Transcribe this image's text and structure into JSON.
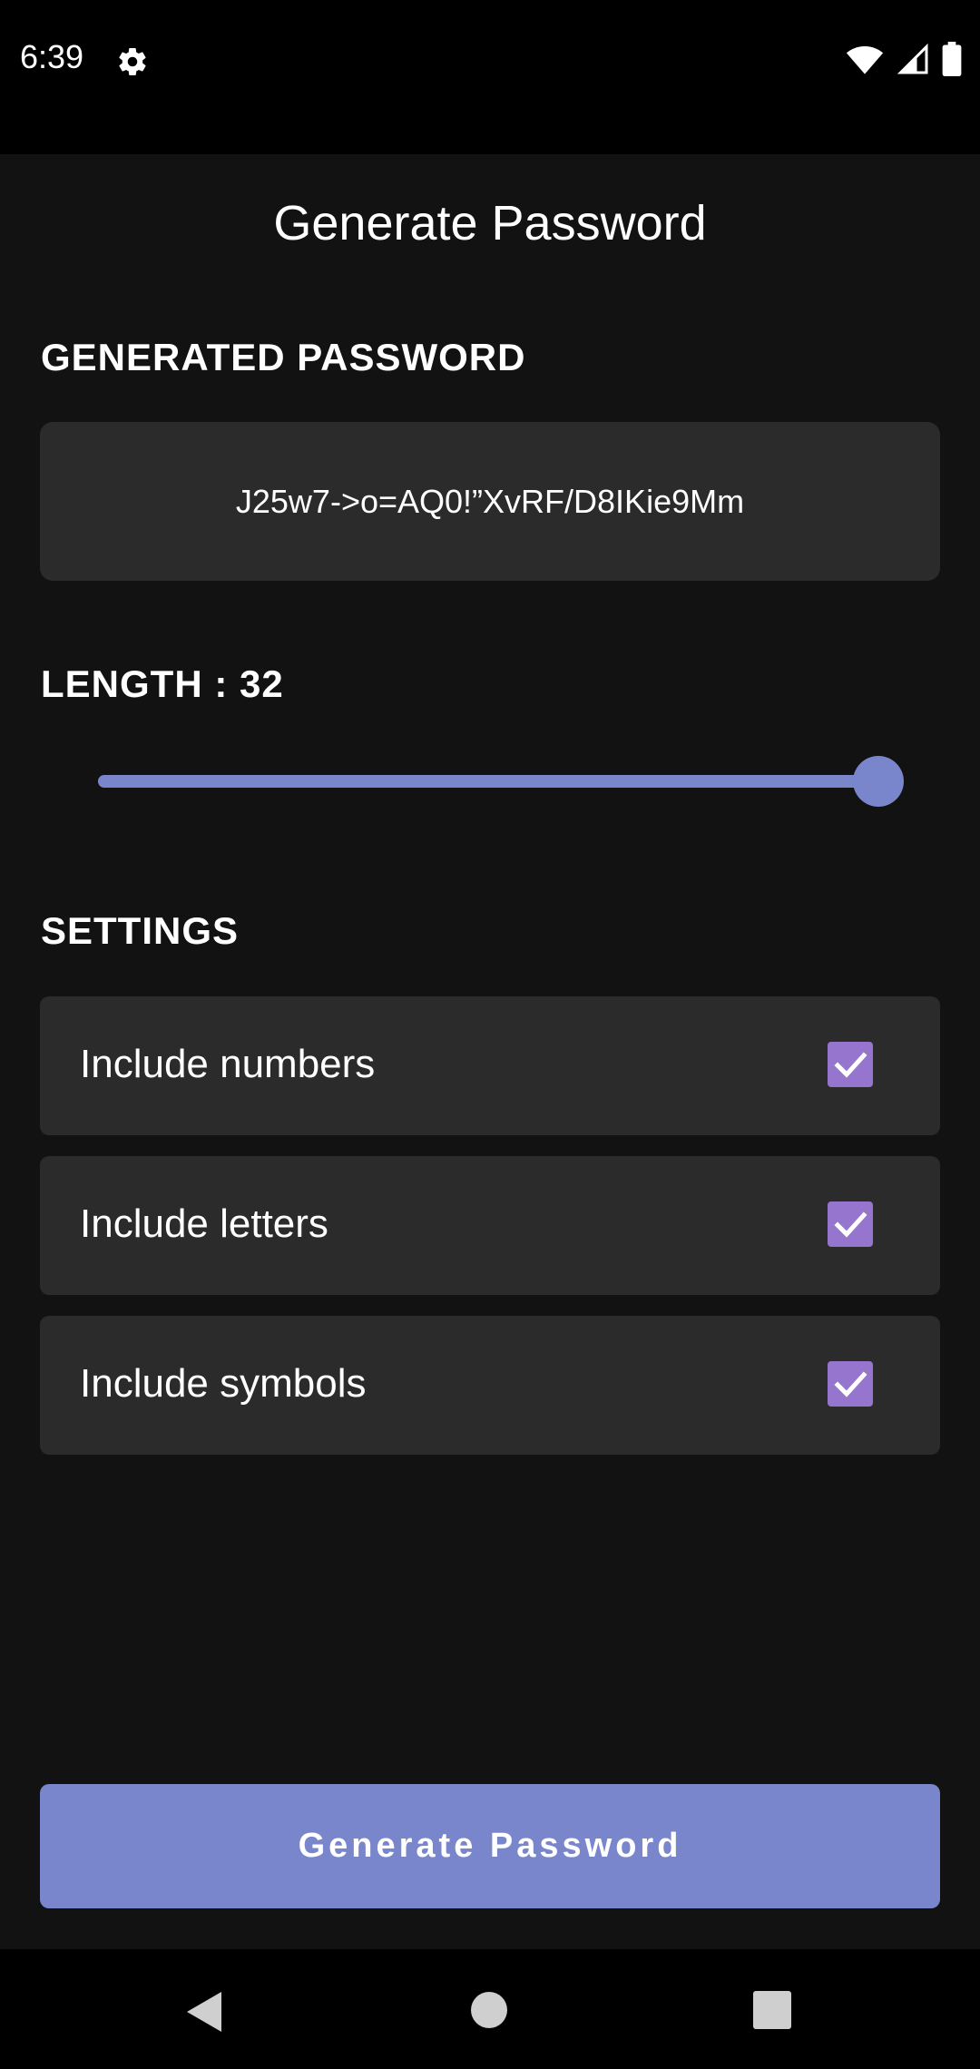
{
  "status_bar": {
    "time": "6:39",
    "icons": [
      "gear-icon",
      "wifi-icon",
      "signal-icon",
      "battery-icon"
    ]
  },
  "screen": {
    "title": "Generate Password"
  },
  "password_section": {
    "label": "GENERATED PASSWORD",
    "value": "J25w7->o=AQ0!”XvRF/D8IKie9Mm"
  },
  "length_section": {
    "label": "LENGTH : 32",
    "value": 32,
    "slider_fraction": 1.0
  },
  "settings_section": {
    "label": "SETTINGS",
    "options": [
      {
        "label": "Include numbers",
        "checked": true
      },
      {
        "label": "Include letters",
        "checked": true
      },
      {
        "label": "Include symbols",
        "checked": true
      }
    ]
  },
  "actions": {
    "generate_label": "Generate Password"
  },
  "nav_bar": {
    "icons": [
      "back-icon",
      "home-icon",
      "recents-icon"
    ]
  },
  "colors": {
    "accent": "#7986cb",
    "checkbox": "#9575cd",
    "background": "#121212",
    "card": "#2b2b2b"
  }
}
